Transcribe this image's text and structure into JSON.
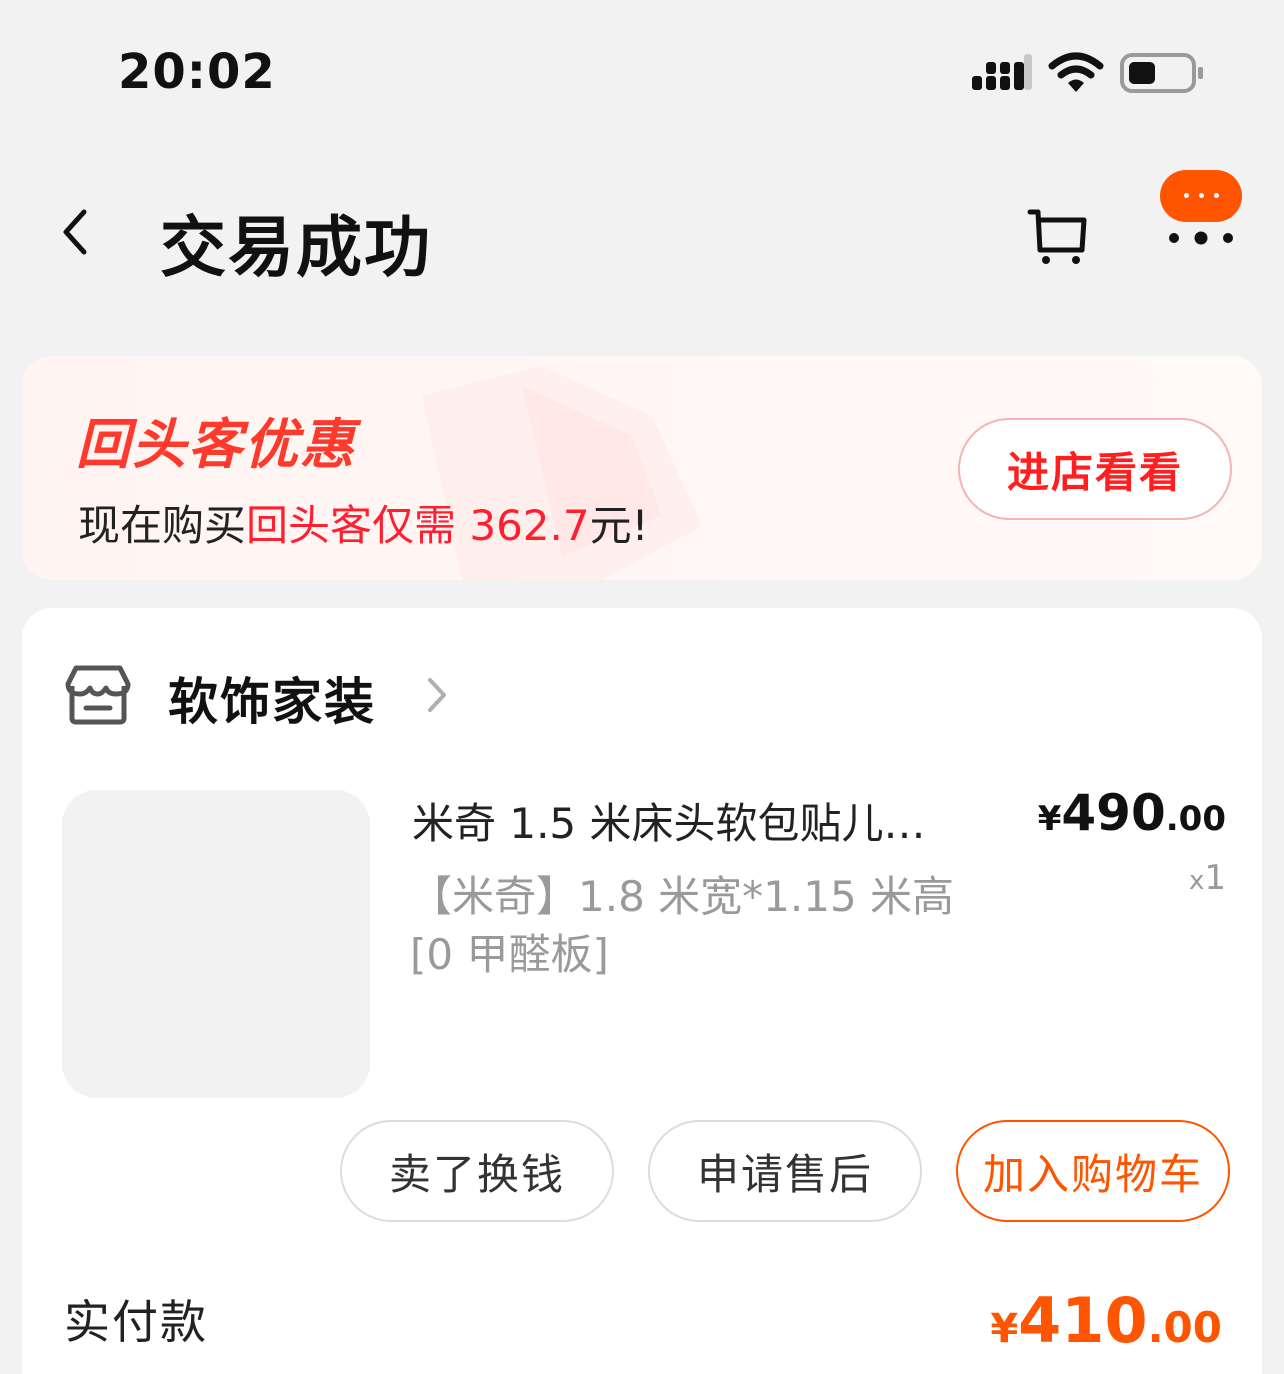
{
  "status_bar": {
    "time": "20:02",
    "icons": [
      "signal-icon",
      "wifi-icon",
      "battery-icon"
    ]
  },
  "nav": {
    "title": "交易成功",
    "icons": [
      "back-icon",
      "cart-icon",
      "more-icon"
    ]
  },
  "banner": {
    "title": "回头客优惠",
    "line_prefix": "现在购买",
    "line_highlight": "回头客仅需 362.7",
    "line_suffix": "元!",
    "button": "进店看看"
  },
  "order": {
    "shop_name": "软饰家装",
    "product_title": "米奇 1.5 米床头软包贴儿…",
    "sku_line1": "【米奇】1.8 米宽*1.15 米高",
    "sku_line2": "[0 甲醛板]",
    "price_symbol": "¥",
    "price_int": "490",
    "price_dec": ".00",
    "qty_prefix": "x",
    "qty": "1",
    "buttons": {
      "sell": "卖了换钱",
      "after_sale": "申请售后",
      "add_cart": "加入购物车"
    },
    "paid_label": "实付款",
    "paid_symbol": "¥",
    "paid_int": "410",
    "paid_dec": ".00"
  },
  "colors": {
    "accent": "#ff5500",
    "promo_red": "#ff1f30",
    "background": "#f2f2f2"
  }
}
